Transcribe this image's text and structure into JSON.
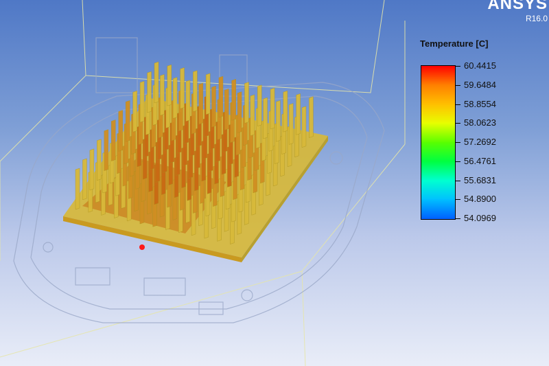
{
  "brand": {
    "name": "ANSYS",
    "version": "R16.0"
  },
  "legend": {
    "title": "Temperature [C]",
    "colors": [
      "#ff0000",
      "#ff8000",
      "#ffc000",
      "#e8ff00",
      "#5aff00",
      "#00ff40",
      "#00ffd0",
      "#00c0ff",
      "#0060ff",
      "#0000ff"
    ],
    "labels": [
      "60.4415",
      "59.6484",
      "58.8554",
      "58.0623",
      "57.2692",
      "56.4761",
      "55.6831",
      "54.8900",
      "54.0969"
    ]
  },
  "scene": {
    "description_icons": [
      "heat-sink-fins",
      "device-housing-wireframe",
      "probe-point-marker"
    ],
    "probe_color": "#ff1a1a"
  }
}
